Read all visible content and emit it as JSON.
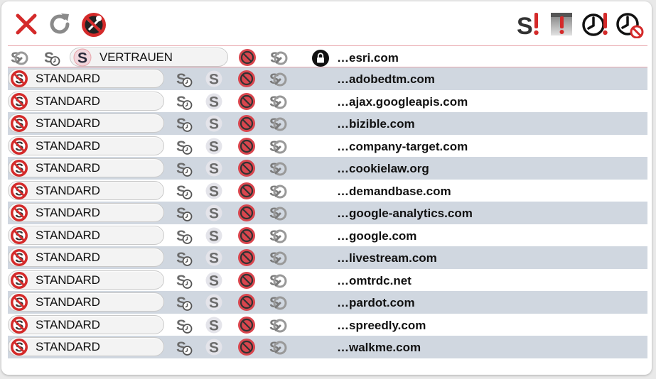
{
  "toolbar": {
    "left": [
      {
        "name": "close-icon",
        "color": "#d42a2a"
      },
      {
        "name": "reload-icon",
        "color": "#888888"
      },
      {
        "name": "no-tools-icon",
        "color": "#d42a2a"
      }
    ],
    "right": [
      {
        "name": "script-warning-icon"
      },
      {
        "name": "page-warning-icon"
      },
      {
        "name": "clock-warning-icon"
      },
      {
        "name": "clock-blocked-icon"
      }
    ]
  },
  "trusted_row": {
    "label": "VERTRAUEN",
    "domain": "…esri.com",
    "locked": true
  },
  "default_label": "STANDARD",
  "domains": [
    "…adobedtm.com",
    "…ajax.googleapis.com",
    "…bizible.com",
    "…company-target.com",
    "…cookielaw.org",
    "…demandbase.com",
    "…google-analytics.com",
    "…google.com",
    "…livestream.com",
    "…omtrdc.net",
    "…pardot.com",
    "…spreedly.com",
    "…walkme.com"
  ],
  "colors": {
    "accent_red": "#d42a2a",
    "row_alt": "#d0d7e0",
    "trusted_border": "#e9a4aa",
    "icon_gray": "#6b6b6b"
  }
}
